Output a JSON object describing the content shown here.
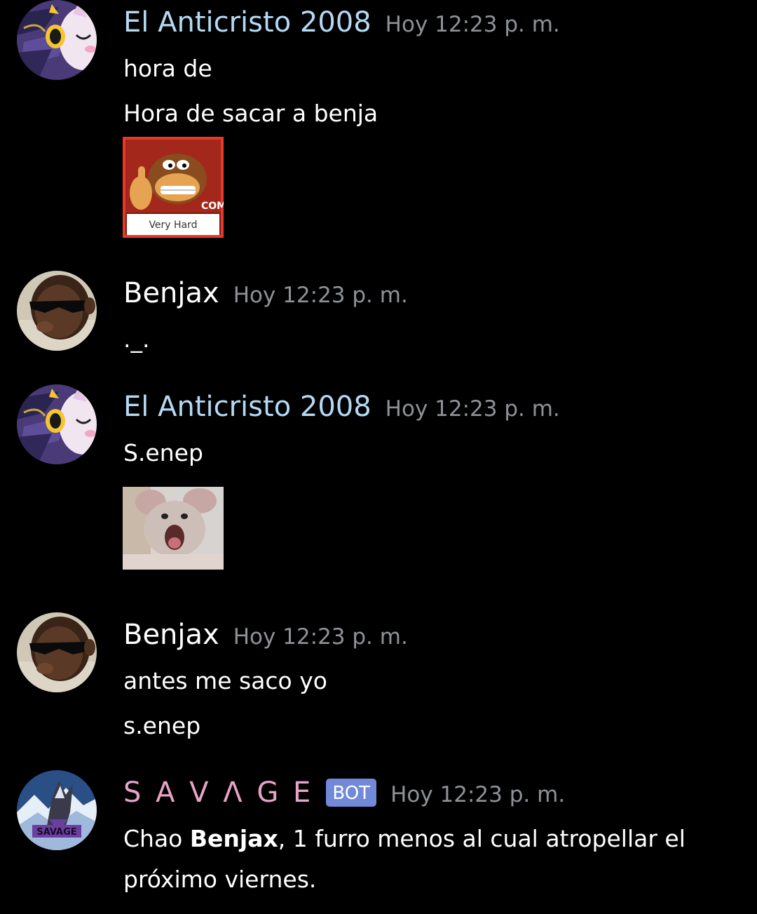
{
  "colors": {
    "background": "#000000",
    "username_anticristo": "#b4d9f3",
    "username_benjax": "#ffffff",
    "username_savage": "#e7a3c9",
    "timestamp": "#8e9297",
    "bot_tag": "#7289da"
  },
  "messages": [
    {
      "author": "El Anticristo 2008",
      "timestamp": "Hoy 12:23 p. m.",
      "avatar_icon": "umbreon-sylveon-avatar",
      "lines": [
        "hora de",
        "Hora de sacar a benja"
      ],
      "image": {
        "icon": "donkey-kong-very-hard-sticker",
        "caption": "Very Hard",
        "badge": "COM"
      }
    },
    {
      "author": "Benjax",
      "timestamp": "Hoy 12:23 p. m.",
      "avatar_icon": "sunglasses-man-avatar",
      "lines": [
        "._."
      ]
    },
    {
      "author": "El Anticristo 2008",
      "timestamp": "Hoy 12:23 p. m.",
      "avatar_icon": "umbreon-sylveon-avatar",
      "lines": [
        "S.enep"
      ],
      "image": {
        "icon": "screaming-rat-image"
      }
    },
    {
      "author": "Benjax",
      "timestamp": "Hoy 12:23 p. m.",
      "avatar_icon": "sunglasses-man-avatar",
      "lines": [
        "antes me saco yo",
        "s.enep"
      ]
    },
    {
      "author": "S A V Λ G E",
      "bot_label": "BOT",
      "timestamp": "Hoy 12:23 p. m.",
      "avatar_icon": "savage-wolf-avatar",
      "avatar_text": "SAVAGE",
      "line_prefix": "Chao ",
      "line_bold": "Benjax",
      "line_suffix": ", 1 furro menos al cual atropellar el",
      "line2": "próximo viernes."
    }
  ]
}
